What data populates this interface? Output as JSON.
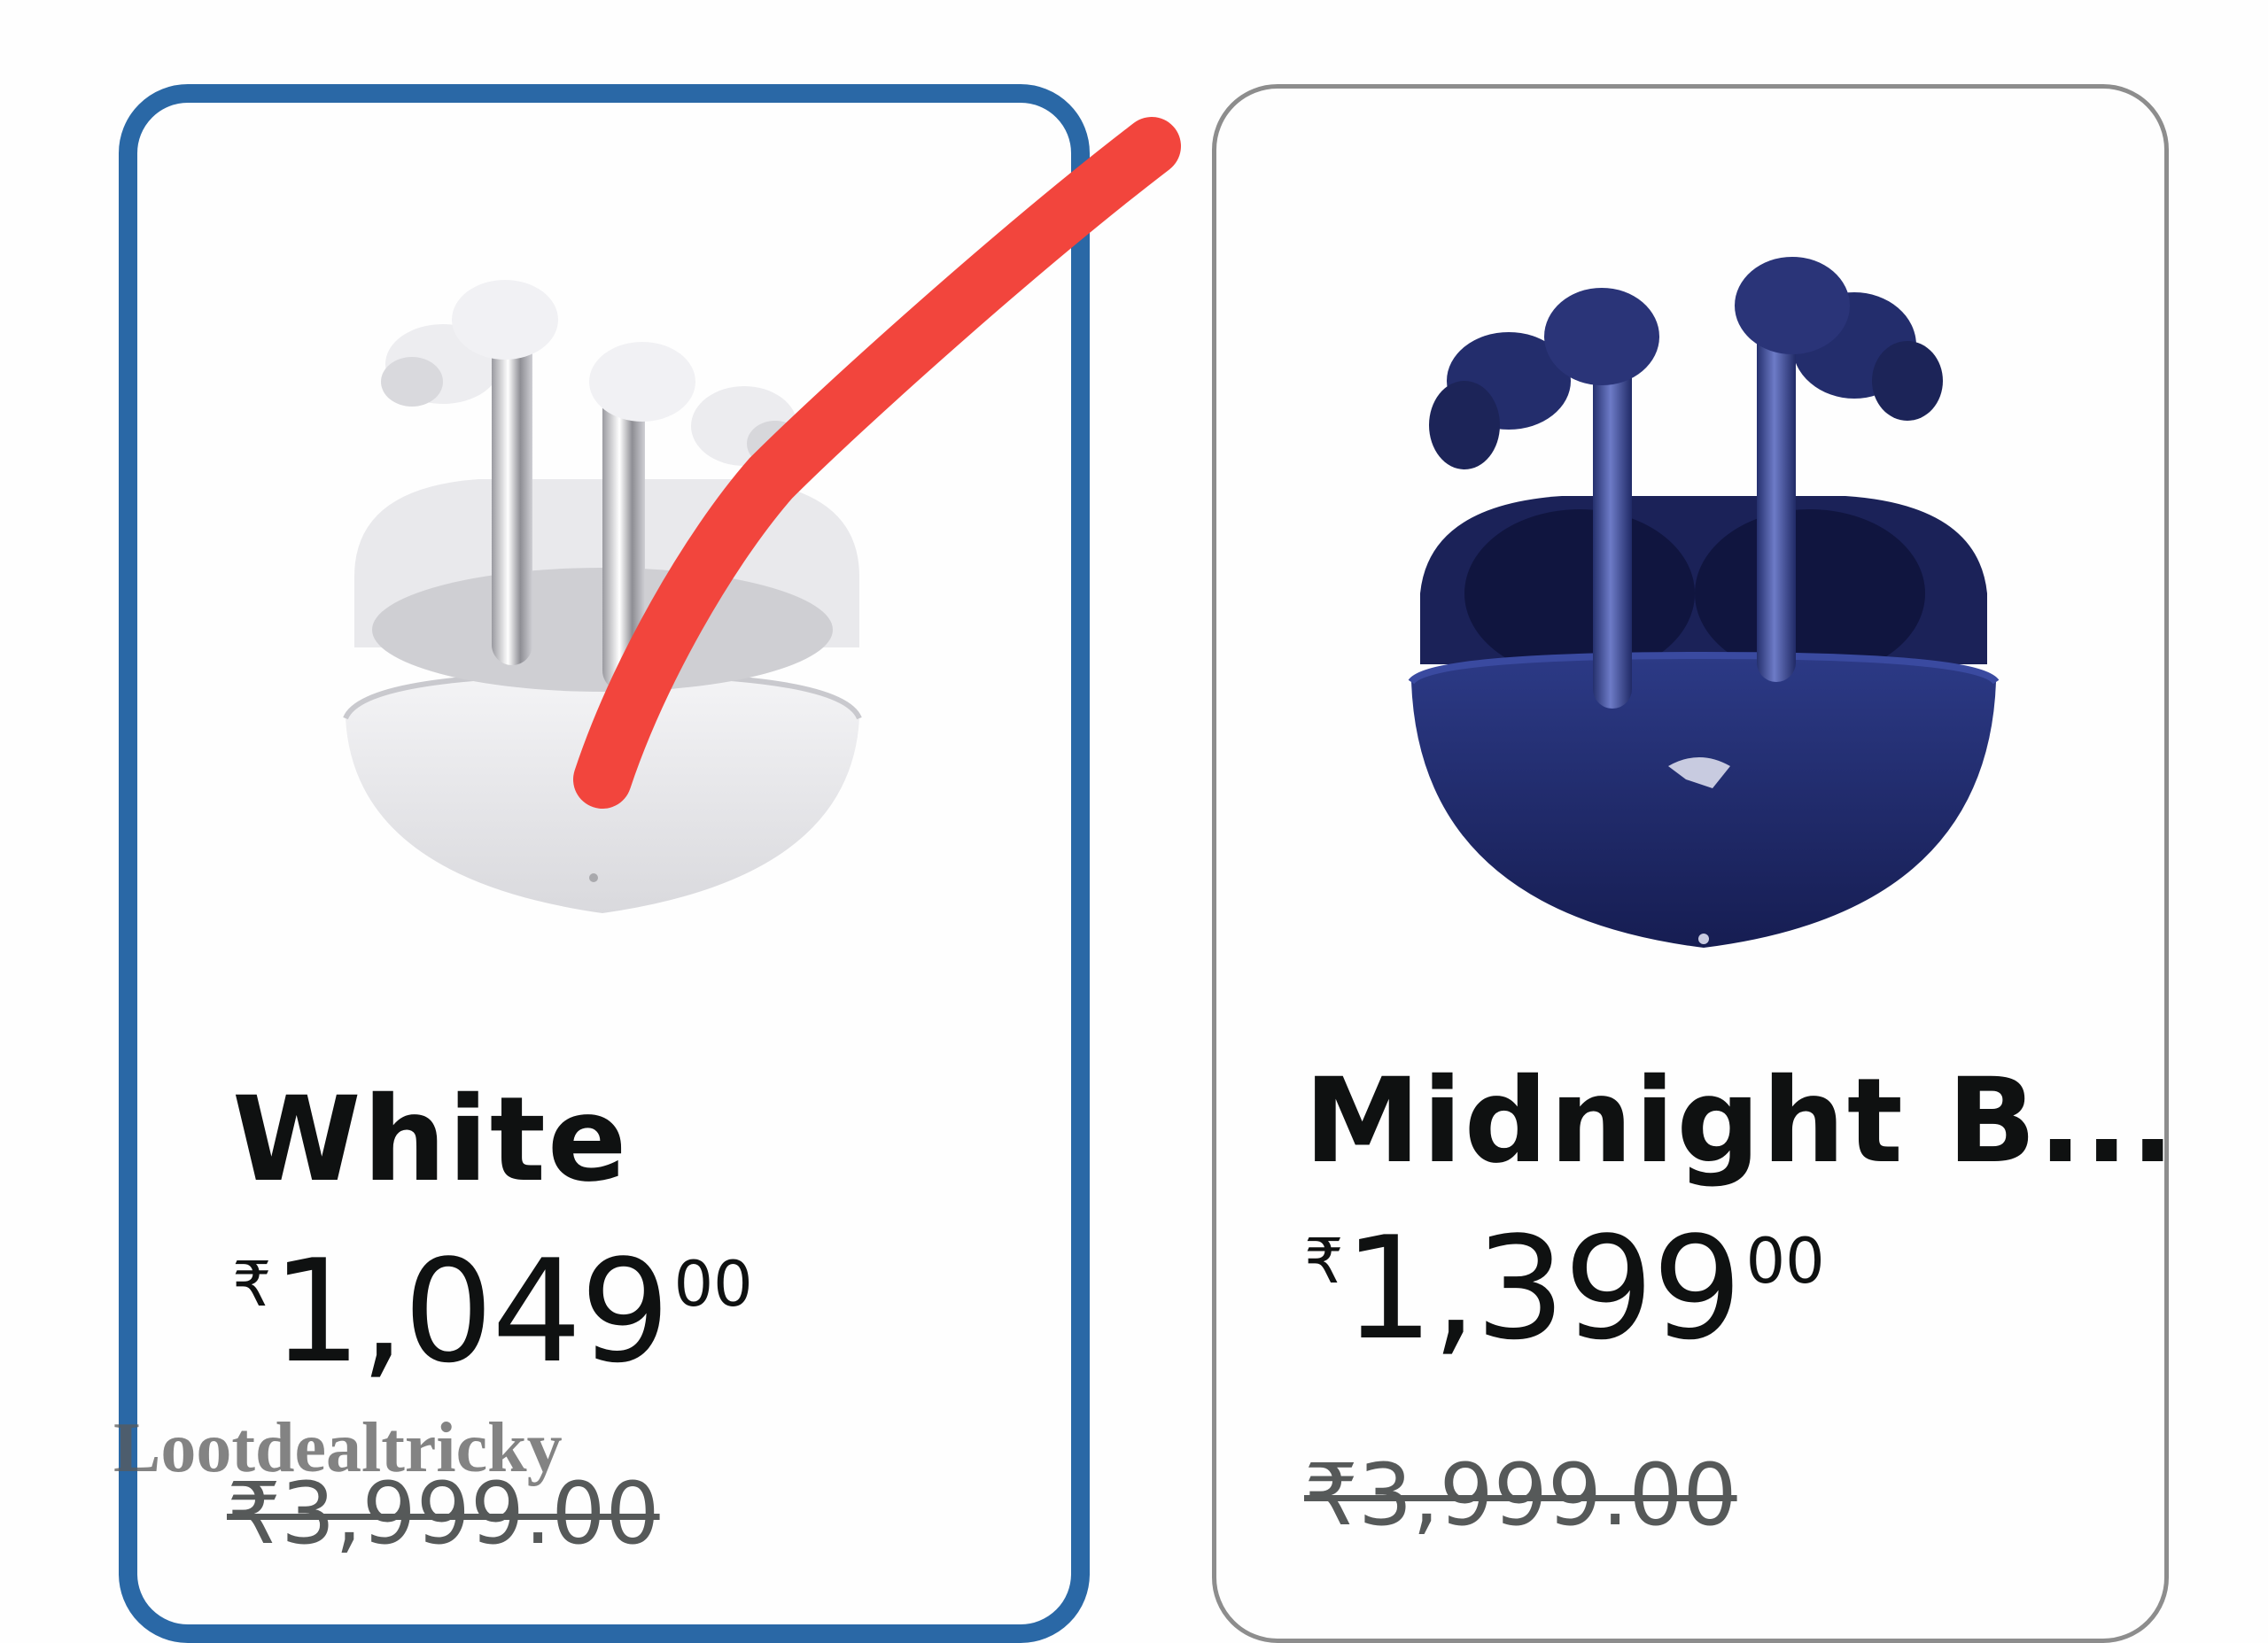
{
  "variants": [
    {
      "name": "White",
      "currency_symbol": "₹",
      "price_whole": "1,049",
      "price_fraction": "00",
      "mrp": "₹3,999.00",
      "selected": true,
      "image": "white-earbuds-image"
    },
    {
      "name": "Midnight B...",
      "currency_symbol": "₹",
      "price_whole": "1,399",
      "price_fraction": "00",
      "mrp": "₹3,999.00",
      "selected": false,
      "image": "midnight-blue-earbuds-image"
    }
  ],
  "watermark": "Lootdealtricky",
  "colors": {
    "selected_border": "#2a68a6",
    "unselected_border": "#8d8d8d",
    "annotation_stroke": "#f2453d",
    "price_text": "#0f1111",
    "mrp_text": "#565959",
    "white_case": "#e6e6e8",
    "blue_case": "#1f2a66"
  }
}
